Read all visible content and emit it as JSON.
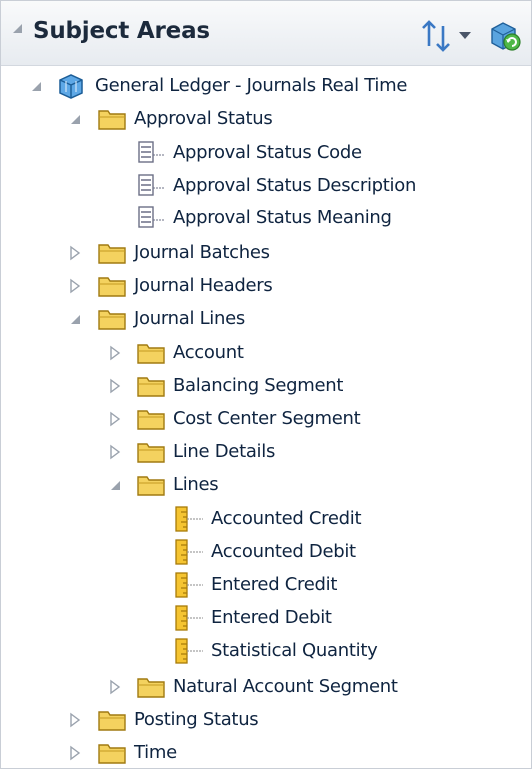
{
  "panel": {
    "title": "Subject Areas"
  },
  "tree": {
    "root": "General Ledger - Journals Real Time",
    "approval_status": {
      "label": "Approval Status",
      "children": [
        "Approval Status Code",
        "Approval Status Description",
        "Approval Status Meaning"
      ]
    },
    "journal_batches": "Journal Batches",
    "journal_headers": "Journal Headers",
    "journal_lines": {
      "label": "Journal Lines",
      "account": "Account",
      "balancing_segment": "Balancing Segment",
      "cost_center_segment": "Cost Center Segment",
      "line_details": "Line Details",
      "lines": {
        "label": "Lines",
        "children": [
          "Accounted Credit",
          "Accounted Debit",
          "Entered Credit",
          "Entered Debit",
          "Statistical Quantity"
        ]
      },
      "natural_account_segment": "Natural Account Segment"
    },
    "posting_status": "Posting Status",
    "time": "Time"
  },
  "icons": {
    "root": "subject-area-cube-icon",
    "folder": "folder-icon",
    "attribute": "attribute-column-icon",
    "measure": "measure-column-icon",
    "sort": "sort-icon",
    "refresh": "refresh-icon"
  },
  "colors": {
    "header_bg": "#e7ebf0",
    "label_text": "#0f2440",
    "folder_fill": "#f4d25f",
    "measure_fill": "#f5c431",
    "expand_arrow": "#9aa2ad"
  }
}
